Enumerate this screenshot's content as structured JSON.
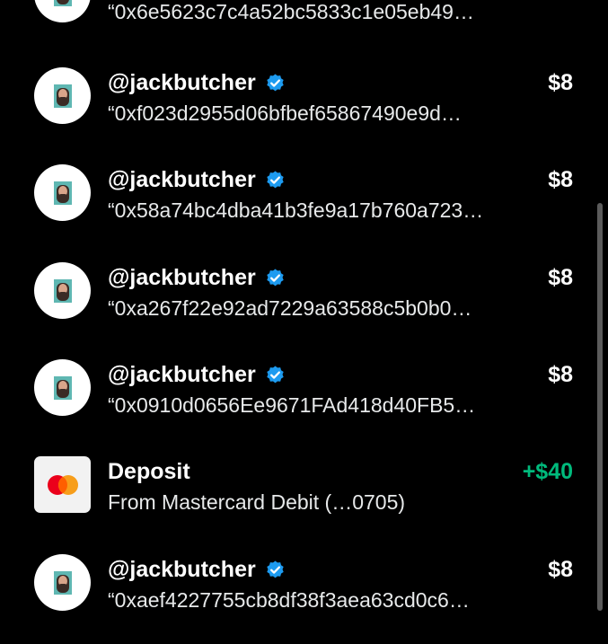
{
  "colors": {
    "background": "#000000",
    "text": "#ffffff",
    "positive_amount": "#00ba7c",
    "verified_badge": "#1d9bf0"
  },
  "transactions": [
    {
      "type": "payment",
      "subtitle": "“0x6e5623c7c4a52bc5833c1e05eb49…",
      "avatar_icon": "user-avatar-icon"
    },
    {
      "type": "payment",
      "name": "@jackbutcher",
      "verified": true,
      "subtitle": "“0xf023d2955d06bfbef65867490e9d…",
      "amount": "$8",
      "avatar_icon": "user-avatar-icon"
    },
    {
      "type": "payment",
      "name": "@jackbutcher",
      "verified": true,
      "subtitle": "“0x58a74bc4dba41b3fe9a17b760a723…",
      "amount": "$8",
      "avatar_icon": "user-avatar-icon"
    },
    {
      "type": "payment",
      "name": "@jackbutcher",
      "verified": true,
      "subtitle": "“0xa267f22e92ad7229a63588c5b0b0…",
      "amount": "$8",
      "avatar_icon": "user-avatar-icon"
    },
    {
      "type": "payment",
      "name": "@jackbutcher",
      "verified": true,
      "subtitle": "“0x0910d0656Ee9671FAd418d40FB5…",
      "amount": "$8",
      "avatar_icon": "user-avatar-icon"
    },
    {
      "type": "deposit",
      "name": "Deposit",
      "subtitle": "From Mastercard Debit (…0705)",
      "amount": "+$40",
      "avatar_icon": "mastercard-icon"
    },
    {
      "type": "payment",
      "name": "@jackbutcher",
      "verified": true,
      "subtitle": "“0xaef4227755cb8df38f3aea63cd0c6…",
      "amount": "$8",
      "avatar_icon": "user-avatar-icon"
    }
  ]
}
